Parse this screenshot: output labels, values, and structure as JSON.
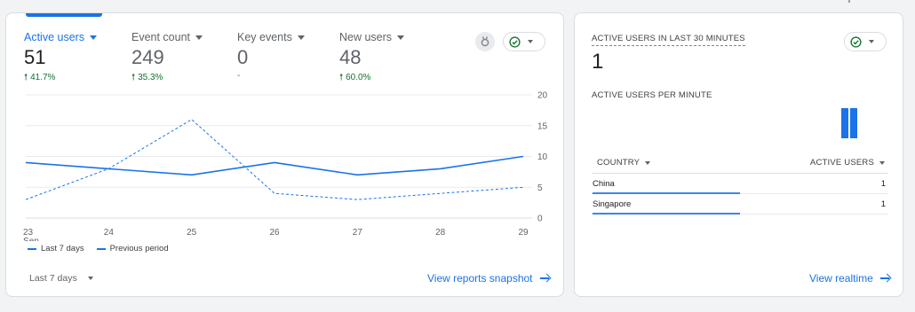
{
  "colors": {
    "accent": "#1a73e8",
    "positive": "#137333",
    "grid": "#e8eaed"
  },
  "overview": {
    "metrics": [
      {
        "label": "Active users",
        "value": "51",
        "delta": "41.7%",
        "delta_icon": "arrow-up-icon",
        "active": true
      },
      {
        "label": "Event count",
        "value": "249",
        "delta": "35.3%",
        "delta_icon": "arrow-up-icon",
        "active": false
      },
      {
        "label": "Key events",
        "value": "0",
        "delta": "-",
        "delta_icon": "",
        "active": false
      },
      {
        "label": "New users",
        "value": "48",
        "delta": "60.0%",
        "delta_icon": "arrow-up-icon",
        "active": false
      }
    ],
    "insights_icon": "insights-badge-icon",
    "status_icon": "check-circle-icon",
    "legend": {
      "current": "Last 7 days",
      "previous": "Previous period"
    },
    "date_range_label": "Last 7 days",
    "view_link": "View reports snapshot"
  },
  "chart_data": {
    "type": "line",
    "x": [
      "23",
      "24",
      "25",
      "26",
      "27",
      "28",
      "29"
    ],
    "x_sublabel": "Sep",
    "ylim": [
      0,
      20
    ],
    "y_ticks": [
      "0",
      "5",
      "10",
      "15",
      "20"
    ],
    "grid": true,
    "legend_position": "bottom-left",
    "series": [
      {
        "name": "Last 7 days",
        "style": "solid",
        "values": [
          9,
          8,
          7,
          9,
          7,
          8,
          10
        ]
      },
      {
        "name": "Previous period",
        "style": "dashed",
        "values": [
          3,
          8,
          16,
          4,
          3,
          4,
          5
        ]
      }
    ]
  },
  "realtime": {
    "title": "ACTIVE USERS IN LAST 30 MINUTES",
    "count": "1",
    "per_minute_label": "ACTIVE USERS PER MINUTE",
    "per_minute_bars": [
      1,
      1
    ],
    "status_icon": "check-circle-icon",
    "table": {
      "col_country": "COUNTRY",
      "col_users": "ACTIVE USERS",
      "rows": [
        {
          "country": "China",
          "users": "1"
        },
        {
          "country": "Singapore",
          "users": "1"
        }
      ]
    },
    "view_link": "View realtime"
  }
}
